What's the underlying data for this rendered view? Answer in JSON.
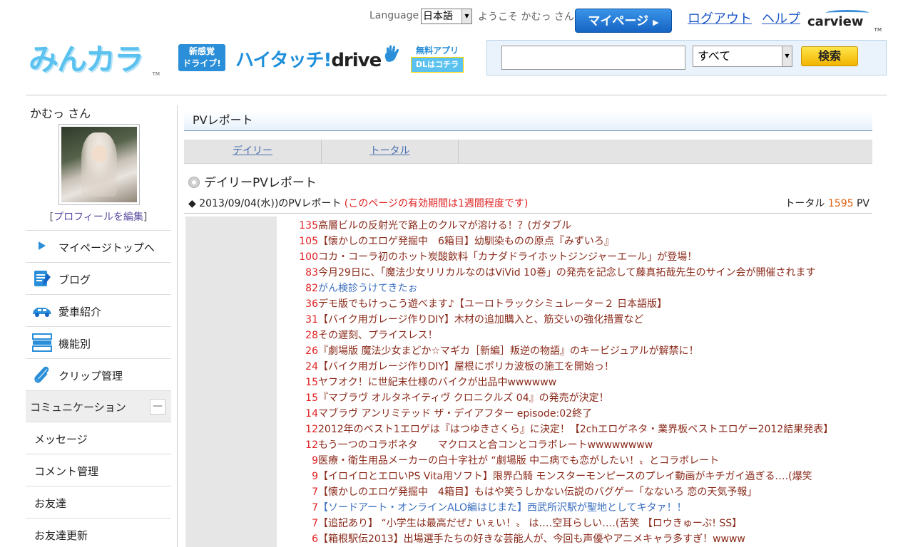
{
  "header": {
    "logo_text": "みんカラ",
    "logo_tm": "TM",
    "language_label": "Language",
    "language_value": "日本語",
    "welcome": "ようこそ かむっ さん",
    "mypage_label": "マイページ",
    "logout_label": "ログアウト",
    "help_label": "ヘルプ",
    "carview_label": "carview",
    "carview_tm": "TM",
    "promo": {
      "badge_line1": "新感覚",
      "badge_line2": "ドライブ!",
      "main_prefix": "ハイタッチ!",
      "main_suffix": "drive",
      "app_free": "無料アプリ",
      "app_dl": "DLはコチラ"
    },
    "search": {
      "input_value": "",
      "category_value": "すべて",
      "button_label": "検索"
    }
  },
  "sidebar": {
    "username": "かむっ さん",
    "edit_profile": "[プロフィールを編集]",
    "edit_profile_link": "プロフィールを編集",
    "items": [
      {
        "label": "マイページトップへ",
        "icon": "arrow-right-icon"
      },
      {
        "label": "ブログ",
        "icon": "blog-icon"
      },
      {
        "label": "愛車紹介",
        "icon": "car-icon"
      },
      {
        "label": "機能別",
        "icon": "list-icon"
      },
      {
        "label": "クリップ管理",
        "icon": "clip-icon"
      }
    ],
    "section_label": "コミュニケーション",
    "section_toggle": "—",
    "sub_items": [
      "メッセージ",
      "コメント管理",
      "お友達",
      "お友達更新"
    ]
  },
  "main": {
    "title": "PVレポート",
    "tabs": [
      "デイリー",
      "トータル"
    ],
    "daily_heading": "デイリーPVレポート",
    "date_text": "◆ 2013/09/04(水))のPVレポート",
    "notice": "(このページの有効期間は1週間程度です)",
    "total_label": "トータル",
    "total_value": "1595",
    "total_unit": "PV",
    "rows": [
      {
        "count": "135",
        "title": "高層ビルの反射光で路上のクルマが溶ける！？(ガタブル",
        "color": "red"
      },
      {
        "count": "105",
        "title": "【懐かしのエロゲ発掘中　6箱目】幼馴染ものの原点『みずいろ』",
        "color": "red"
      },
      {
        "count": "100",
        "title": "コカ・コーラ初のホット炭酸飲料「カナダドライホットジンジャーエール」が登場！",
        "color": "red"
      },
      {
        "count": "83",
        "title": "今月29日に、「魔法少女リリカルなのはViVid 10巻」の発売を記念して藤真拓哉先生のサイン会が開催されます",
        "color": "red"
      },
      {
        "count": "82",
        "title": "がん検診うけてきたぉ",
        "color": "blue"
      },
      {
        "count": "36",
        "title": "デモ版でもけっこう遊べます♪【ユーロトラックシミュレーター２ 日本語版】",
        "color": "red"
      },
      {
        "count": "31",
        "title": "【バイク用ガレージ作りDIY】木材の追加購入と、筋交いの強化措置など",
        "color": "red"
      },
      {
        "count": "28",
        "title": "その遅刻、プライスレス！",
        "color": "red"
      },
      {
        "count": "26",
        "title": "『劇場版 魔法少女まどか☆マギカ［新編］叛逆の物語』のキービジュアルが解禁に！",
        "color": "red"
      },
      {
        "count": "24",
        "title": "【バイク用ガレージ作りDIY】屋根にポリカ波板の施工を開始っ！",
        "color": "red"
      },
      {
        "count": "15",
        "title": "ヤフオク！に世紀末仕様のバイクが出品中wwwwww",
        "color": "red"
      },
      {
        "count": "15",
        "title": "『マブラヴ オルタネイティヴ クロニクルズ 04』の発売が決定！",
        "color": "red"
      },
      {
        "count": "14",
        "title": "マブラヴ アンリミテッド ザ・デイアフター episode:02終了",
        "color": "red"
      },
      {
        "count": "12",
        "title": "2012年のベスト1エロゲは『はつゆきさくら』に決定！【2chエロゲネタ・業界板ベストエロゲー2012結果発表】",
        "color": "red"
      },
      {
        "count": "12",
        "title": "もう一つのコラボネタ　　マクロスと合コンとコラボレートwwwwwwww",
        "color": "red"
      },
      {
        "count": "9",
        "title": "医療・衛生用品メーカーの白十字社が “劇場版 中二病でも恋がしたい！〟とコラボレート",
        "color": "red"
      },
      {
        "count": "9",
        "title": "【イロイロとエロいPS Vita用ソフト】限界凸騎 モンスターモンピースのプレイ動画がキチガイ過ぎる‥‥(爆笑",
        "color": "red"
      },
      {
        "count": "7",
        "title": "【懐かしのエロゲ発掘中　4箱目】もはや笑うしかない伝説のバグゲー「なないろ 恋の天気予報」",
        "color": "red"
      },
      {
        "count": "7",
        "title": "【ソードアート・オンラインALO編はじまた】西武所沢駅が聖地としてキタァ！！",
        "color": "blue"
      },
      {
        "count": "7",
        "title": "【追記あり】 “小学生は最高だぜ♪ いぇい！〟 は‥‥空耳らしい‥‥(苦笑 【ロウきゅーぶ! SS】",
        "color": "red"
      },
      {
        "count": "6",
        "title": "【箱根駅伝2013】出場選手たちの好きな芸能人が、今回も声優やアニメキャラ多すぎ！wwww",
        "color": "red"
      }
    ]
  },
  "colors": {
    "accent_blue": "#2a8fd8",
    "count_red": "#e02020",
    "title_brown": "#8a2a1a",
    "title_blue": "#3a6ec0"
  }
}
